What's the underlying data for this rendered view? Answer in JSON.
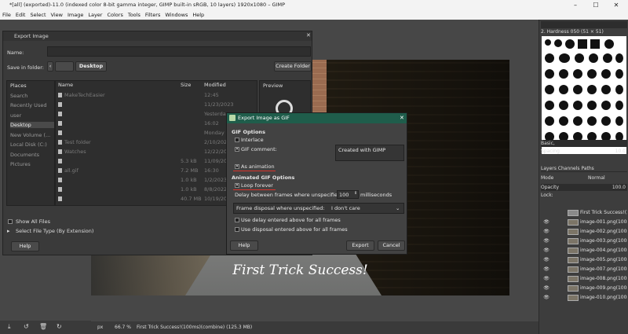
{
  "window": {
    "title": "*[all] (exported)-11.0 (indexed color 8-bit gamma integer, GIMP built-in sRGB, 10 layers) 1920x1080 – GIMP",
    "minimize": "–",
    "maximize": "☐",
    "close": "✕"
  },
  "menu": [
    "File",
    "Edit",
    "Select",
    "View",
    "Image",
    "Layer",
    "Colors",
    "Tools",
    "Filters",
    "Windows",
    "Help"
  ],
  "image": {
    "caption": "First Trick Success!"
  },
  "statusbar": {
    "unit": "px",
    "zoom": "66.7 %",
    "layer_info": "First Trick Success!(100ms)(combine) (125.3 MB)"
  },
  "export_dialog": {
    "title": "Export Image",
    "name_label": "Name:",
    "save_in_label": "Save in folder:",
    "folder_path_sep": "‹",
    "folder_crumb": "Desktop",
    "create_folder": "Create Folder",
    "places_header": "Places",
    "name_header": "Name",
    "size_header": "Size",
    "modified_header": "Modified",
    "preview_header": "Preview",
    "places": [
      "Search",
      "Recently Used",
      "user",
      "Desktop",
      "New Volume (...",
      "Local Disk (C:)",
      "Documents",
      "Pictures"
    ],
    "files": [
      {
        "name": "MakeTechEasier",
        "size": "",
        "modified": "12:45"
      },
      {
        "name": "",
        "size": "",
        "modified": "11/23/2023"
      },
      {
        "name": "",
        "size": "",
        "modified": "Yesterday"
      },
      {
        "name": "",
        "size": "",
        "modified": "16:02"
      },
      {
        "name": "",
        "size": "",
        "modified": "Monday"
      },
      {
        "name": "Test folder",
        "size": "",
        "modified": "2/10/2023"
      },
      {
        "name": "Watches",
        "size": "",
        "modified": "12/22/2023"
      },
      {
        "name": "",
        "size": "5.3 kB",
        "modified": "11/09/2023"
      },
      {
        "name": "all.gif",
        "size": "7.2 MB",
        "modified": "16:30"
      },
      {
        "name": "",
        "size": "1.0 kB",
        "modified": "1/2/2023"
      },
      {
        "name": "",
        "size": "1.0 kB",
        "modified": "8/8/2022"
      },
      {
        "name": "",
        "size": "40.7 MB",
        "modified": "10/19/2022"
      },
      {
        "name": "",
        "size": "10 kB",
        "modified": "10/25/2022"
      }
    ],
    "show_all_files": "Show All Files",
    "select_file_type": "Select File Type (By Extension)",
    "help": "Help"
  },
  "gif_dialog": {
    "title": "Export Image as GIF",
    "close": "✕",
    "gif_options_heading": "GIF Options",
    "interlace": "Interlace",
    "gif_comment": "GIF comment:",
    "comment_value": "Created with GIMP",
    "as_animation": "As animation",
    "animated_heading": "Animated GIF Options",
    "loop_forever": "Loop forever",
    "delay_label": "Delay between frames where unspecified:",
    "delay_value": "100",
    "delay_unit": "milliseconds",
    "disposal_label": "Frame disposal where unspecified:",
    "disposal_value": "I don't care",
    "use_delay": "Use delay entered above for all frames",
    "use_disposal": "Use disposal entered above for all frames",
    "help": "Help",
    "export": "Export",
    "cancel": "Cancel",
    "interlace_checked": false,
    "comment_checked": true,
    "as_animation_checked": true,
    "loop_forever_checked": true
  },
  "dock": {
    "brush_name": "2. Hardness 050 (51 × 51)",
    "basic": "Basic,",
    "spacing_label": "Spacing",
    "spacing_value": "10.0",
    "tabs": [
      "Layers",
      "Channels",
      "Paths"
    ],
    "mode_label": "Mode",
    "mode_value": "Normal",
    "opacity_label": "Opacity",
    "opacity_value": "100.0",
    "lock_label": "Lock:",
    "layers": [
      "First Trick Success!(100ms)",
      "image-001.png(100ms)(",
      "image-002.png(100ms)(",
      "image-003.png(100ms)(",
      "image-004.png(100ms)(",
      "image-005.png(100ms)(",
      "image-007.png(100ms)(",
      "image-008.png(100ms)(",
      "image-009.png(100ms)(",
      "image-010.png(100ms)("
    ]
  }
}
